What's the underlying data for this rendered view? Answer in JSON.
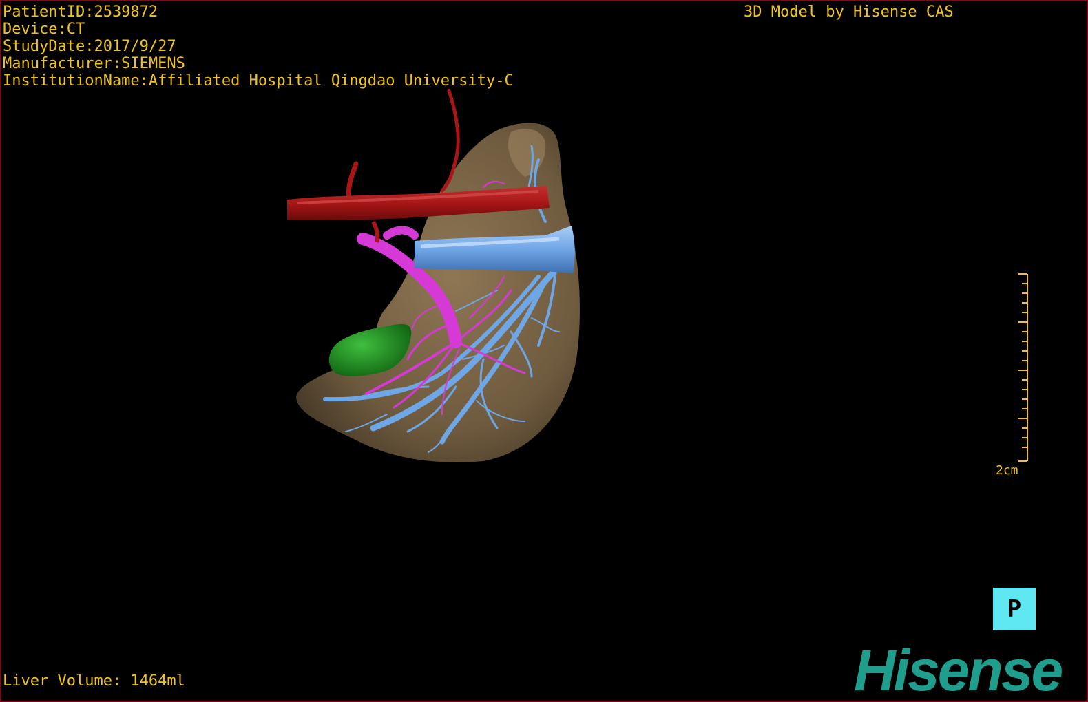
{
  "patient_info": {
    "patient_id": "PatientID:2539872",
    "device": "Device:CT",
    "study_date": "StudyDate:2017/9/27",
    "manufacturer": "Manufacturer:SIEMENS",
    "institution": "InstitutionName:Affiliated Hospital Qingdao University-C"
  },
  "credit": "3D Model by Hisense CAS",
  "liver_volume": "Liver Volume: 1464ml",
  "scale_bar": {
    "label": "2cm"
  },
  "orientation": {
    "letter": "P"
  },
  "logo": "Hisense",
  "colors": {
    "text": "#f2c419",
    "liver": "#7d6648",
    "artery": "#a81616",
    "portal_vein": "#d63ad6",
    "hepatic_vein": "#6fa6e6",
    "lesion": "#1f8f1f",
    "orientation_box": "#5fe8f2",
    "logo": "#1f9e8e",
    "frame": "#7a0f1c"
  },
  "icons": {
    "orientation": "orientation-cube-icon",
    "scale": "scale-ruler-icon",
    "logo": "hisense-logo"
  }
}
